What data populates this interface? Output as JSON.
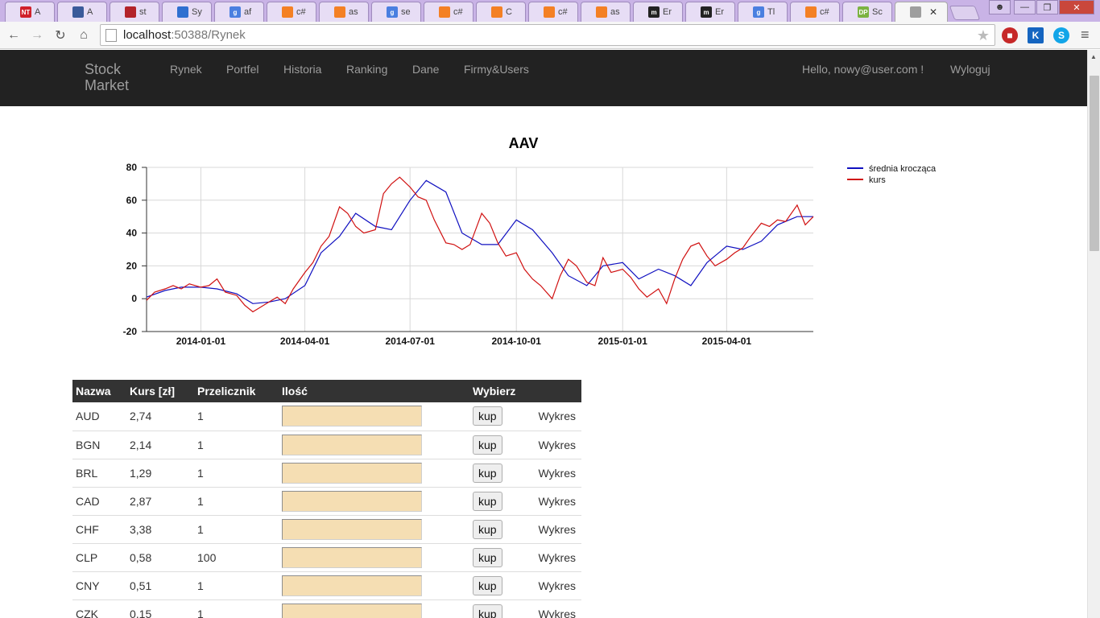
{
  "browser": {
    "tabs": [
      {
        "title": "A",
        "fav_label": "NT",
        "fav_color": "#d0202a"
      },
      {
        "title": "A",
        "fav_label": "",
        "fav_color": "#3a5a9a"
      },
      {
        "title": "st",
        "fav_label": "",
        "fav_color": "#b3232a"
      },
      {
        "title": "Sy",
        "fav_label": "",
        "fav_color": "#2f6fd0"
      },
      {
        "title": "af",
        "fav_label": "g",
        "fav_color": "#4a7fe0"
      },
      {
        "title": "c#",
        "fav_label": "",
        "fav_color": "#f48024"
      },
      {
        "title": "as",
        "fav_label": "",
        "fav_color": "#f48024"
      },
      {
        "title": "se",
        "fav_label": "g",
        "fav_color": "#4a7fe0"
      },
      {
        "title": "c#",
        "fav_label": "",
        "fav_color": "#f48024"
      },
      {
        "title": "C",
        "fav_label": "",
        "fav_color": "#f48024"
      },
      {
        "title": "c#",
        "fav_label": "",
        "fav_color": "#f48024"
      },
      {
        "title": "as",
        "fav_label": "",
        "fav_color": "#f48024"
      },
      {
        "title": "Er",
        "fav_label": "m",
        "fav_color": "#222222"
      },
      {
        "title": "Er",
        "fav_label": "m",
        "fav_color": "#222222"
      },
      {
        "title": "Tl",
        "fav_label": "g",
        "fav_color": "#4a7fe0"
      },
      {
        "title": "c#",
        "fav_label": "",
        "fav_color": "#f48024"
      },
      {
        "title": "Sc",
        "fav_label": "DP",
        "fav_color": "#7cb342"
      },
      {
        "title": "",
        "fav_label": "",
        "fav_color": "#9e9e9e",
        "active": true
      }
    ],
    "address": {
      "host": "localhost",
      "path": ":50388/Rynek"
    }
  },
  "navbar": {
    "brand": "Stock Market",
    "items": [
      "Rynek",
      "Portfel",
      "Historia",
      "Ranking",
      "Dane",
      "Firmy&Users"
    ],
    "hello": "Hello, nowy@user.com !",
    "logout": "Wyloguj"
  },
  "chart_data": {
    "type": "line",
    "title": "AAV",
    "xlabel": "",
    "ylabel": "",
    "ylim": [
      -20,
      80
    ],
    "yticks": [
      -20,
      0,
      20,
      40,
      60,
      80
    ],
    "xlim": [
      "2013-11-15",
      "2015-06-15"
    ],
    "xticks": [
      "2014-01-01",
      "2014-04-01",
      "2014-07-01",
      "2014-10-01",
      "2015-01-01",
      "2015-04-01"
    ],
    "grid": true,
    "legend_position": "right",
    "series": [
      {
        "name": "średnia krocząca",
        "color": "#1010c0",
        "x": [
          "2013-11-15",
          "2013-12-01",
          "2013-12-15",
          "2014-01-01",
          "2014-01-15",
          "2014-02-01",
          "2014-02-15",
          "2014-03-01",
          "2014-03-15",
          "2014-04-01",
          "2014-04-15",
          "2014-05-01",
          "2014-05-15",
          "2014-06-01",
          "2014-06-15",
          "2014-07-01",
          "2014-07-15",
          "2014-08-01",
          "2014-08-15",
          "2014-09-01",
          "2014-09-15",
          "2014-10-01",
          "2014-10-15",
          "2014-11-01",
          "2014-11-15",
          "2014-12-01",
          "2014-12-15",
          "2015-01-01",
          "2015-01-15",
          "2015-02-01",
          "2015-02-15",
          "2015-03-01",
          "2015-03-15",
          "2015-04-01",
          "2015-04-15",
          "2015-05-01",
          "2015-05-15",
          "2015-06-01",
          "2015-06-15"
        ],
        "values": [
          1,
          5,
          7,
          7,
          6,
          3,
          -3,
          -2,
          0,
          8,
          28,
          38,
          52,
          44,
          42,
          60,
          72,
          65,
          40,
          33,
          33,
          48,
          42,
          28,
          14,
          8,
          20,
          22,
          12,
          18,
          14,
          8,
          22,
          32,
          30,
          35,
          45,
          50,
          50
        ]
      },
      {
        "name": "kurs",
        "color": "#d01010",
        "x": [
          "2013-11-15",
          "2013-11-22",
          "2013-12-01",
          "2013-12-08",
          "2013-12-15",
          "2013-12-22",
          "2014-01-01",
          "2014-01-08",
          "2014-01-15",
          "2014-01-22",
          "2014-02-01",
          "2014-02-08",
          "2014-02-15",
          "2014-02-22",
          "2014-03-01",
          "2014-03-08",
          "2014-03-15",
          "2014-03-22",
          "2014-04-01",
          "2014-04-08",
          "2014-04-15",
          "2014-04-22",
          "2014-05-01",
          "2014-05-08",
          "2014-05-15",
          "2014-05-22",
          "2014-06-01",
          "2014-06-08",
          "2014-06-15",
          "2014-06-22",
          "2014-07-01",
          "2014-07-08",
          "2014-07-15",
          "2014-07-22",
          "2014-08-01",
          "2014-08-08",
          "2014-08-15",
          "2014-08-22",
          "2014-09-01",
          "2014-09-08",
          "2014-09-15",
          "2014-09-22",
          "2014-10-01",
          "2014-10-08",
          "2014-10-15",
          "2014-10-22",
          "2014-11-01",
          "2014-11-08",
          "2014-11-15",
          "2014-11-22",
          "2014-12-01",
          "2014-12-08",
          "2014-12-15",
          "2014-12-22",
          "2015-01-01",
          "2015-01-08",
          "2015-01-15",
          "2015-01-22",
          "2015-02-01",
          "2015-02-08",
          "2015-02-15",
          "2015-02-22",
          "2015-03-01",
          "2015-03-08",
          "2015-03-15",
          "2015-03-22",
          "2015-04-01",
          "2015-04-08",
          "2015-04-15",
          "2015-04-22",
          "2015-05-01",
          "2015-05-08",
          "2015-05-15",
          "2015-05-22",
          "2015-06-01",
          "2015-06-08",
          "2015-06-15"
        ],
        "values": [
          -1,
          4,
          6,
          8,
          6,
          9,
          7,
          8,
          12,
          4,
          2,
          -4,
          -8,
          -5,
          -2,
          1,
          -3,
          6,
          16,
          22,
          32,
          38,
          56,
          52,
          44,
          40,
          42,
          64,
          70,
          74,
          68,
          62,
          60,
          48,
          34,
          33,
          30,
          33,
          52,
          46,
          34,
          26,
          28,
          18,
          12,
          8,
          0,
          14,
          24,
          20,
          10,
          8,
          25,
          16,
          18,
          13,
          6,
          1,
          6,
          -3,
          12,
          24,
          32,
          34,
          26,
          20,
          24,
          28,
          31,
          38,
          46,
          44,
          48,
          47,
          57,
          45,
          50
        ]
      }
    ]
  },
  "table": {
    "headers": [
      "Nazwa",
      "Kurs [zł]",
      "Przelicznik",
      "Ilość",
      "Wybierz",
      ""
    ],
    "buy_label": "kup",
    "chart_label": "Wykres",
    "rows": [
      {
        "name": "AUD",
        "rate": "2,74",
        "factor": "1"
      },
      {
        "name": "BGN",
        "rate": "2,14",
        "factor": "1"
      },
      {
        "name": "BRL",
        "rate": "1,29",
        "factor": "1"
      },
      {
        "name": "CAD",
        "rate": "2,87",
        "factor": "1"
      },
      {
        "name": "CHF",
        "rate": "3,38",
        "factor": "1"
      },
      {
        "name": "CLP",
        "rate": "0,58",
        "factor": "100"
      },
      {
        "name": "CNY",
        "rate": "0,51",
        "factor": "1"
      },
      {
        "name": "CZK",
        "rate": "0,15",
        "factor": "1"
      }
    ]
  }
}
